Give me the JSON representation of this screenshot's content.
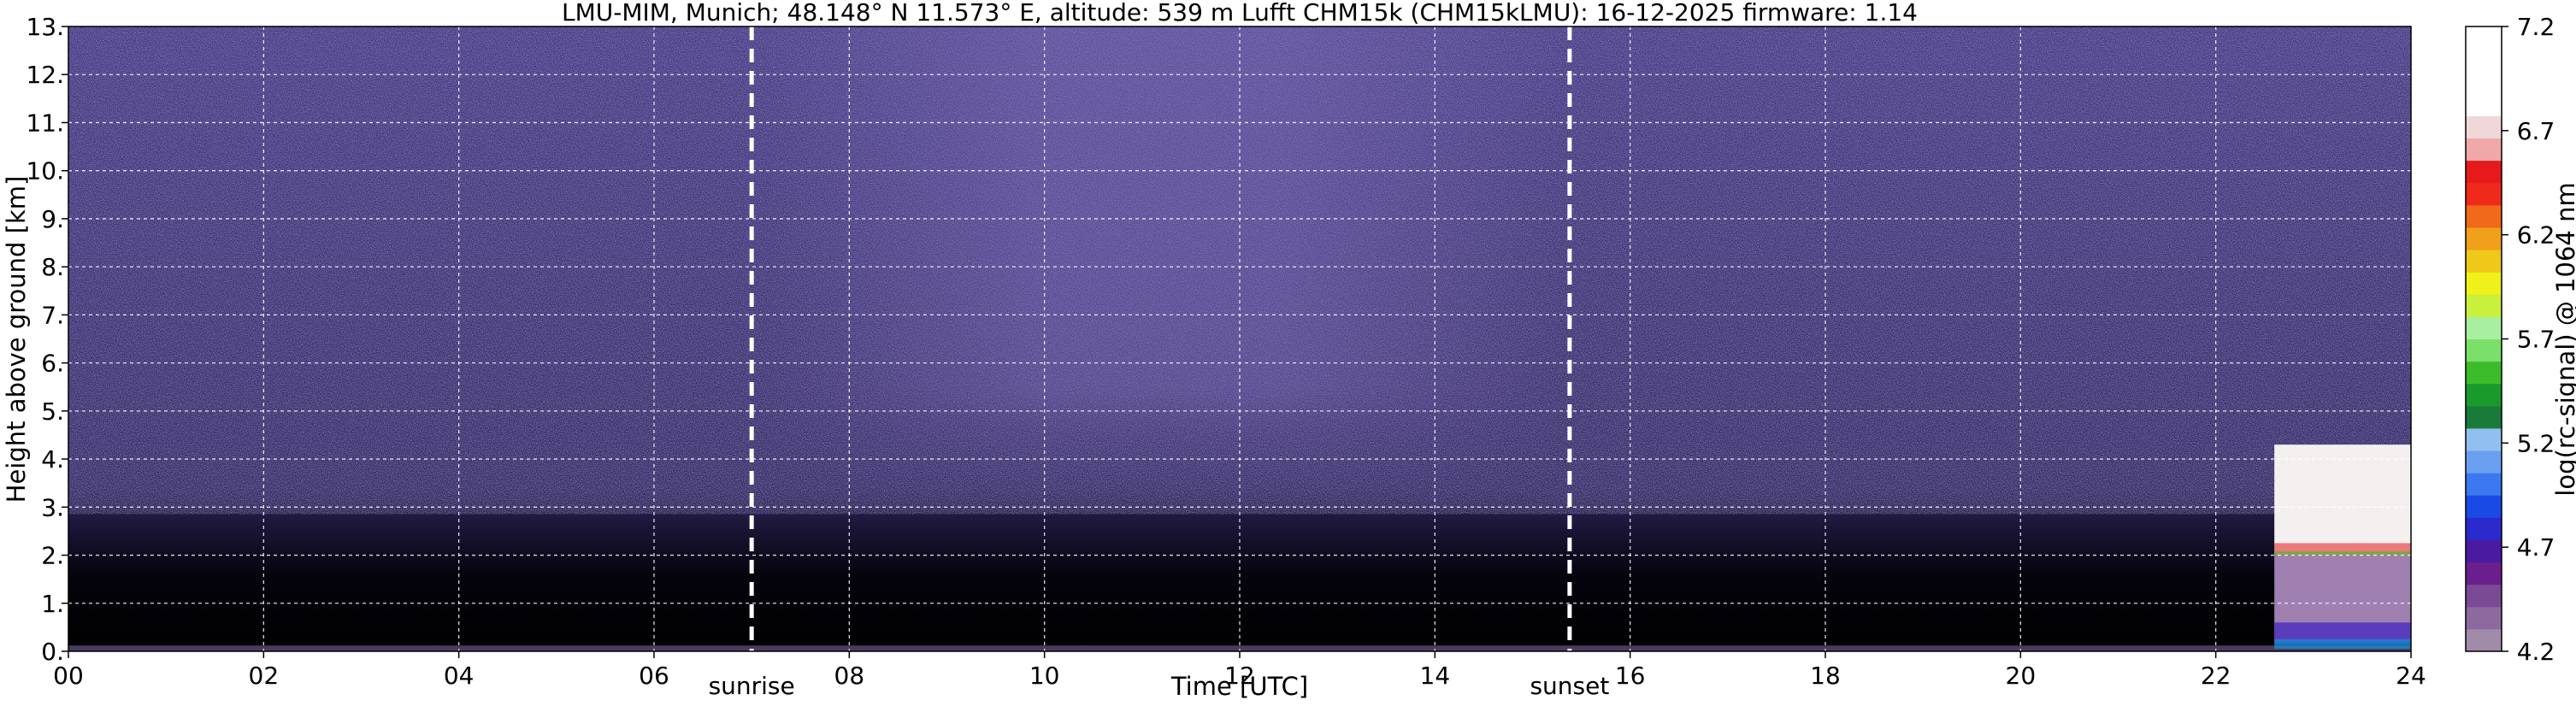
{
  "chart_data": {
    "type": "heatmap",
    "title": "LMU-MIM, Munich; 48.148° N 11.573° E, altitude: 539 m    Lufft CHM15k (CHM15kLMU): 16-12-2025    firmware: 1.14",
    "xlabel": "Time [UTC]",
    "ylabel": "Height above ground [km]",
    "xlim": [
      0,
      24
    ],
    "ylim": [
      0,
      13
    ],
    "x_ticks": [
      "00",
      "02",
      "04",
      "06",
      "08",
      "10",
      "12",
      "14",
      "16",
      "18",
      "20",
      "22",
      "24"
    ],
    "y_ticks": [
      "0.",
      "1.",
      "2.",
      "3.",
      "4.",
      "5.",
      "6.",
      "7.",
      "8.",
      "9.",
      "10.",
      "11.",
      "12.",
      "13."
    ],
    "grid": true,
    "colorbar": {
      "label": "log(rc-signal) @ 1064 nm",
      "range": [
        4.2,
        7.2
      ],
      "ticks": [
        "4.2",
        "4.7",
        "5.2",
        "5.7",
        "6.2",
        "6.7",
        "7.2"
      ],
      "colors": [
        "#a08ca8",
        "#8c6aa0",
        "#7a4a94",
        "#6a1f8c",
        "#4a1aa0",
        "#2a2acc",
        "#1a4ae6",
        "#3c78f0",
        "#6aa0f0",
        "#90c0f0",
        "#1a7a3a",
        "#1a9a2a",
        "#3cbc2a",
        "#7ae06a",
        "#a8f0a0",
        "#c8f03c",
        "#f0f01a",
        "#f0c81a",
        "#f0a01a",
        "#f06a1a",
        "#f02a1a",
        "#e61a1a",
        "#f0a8a8",
        "#f0d8d8",
        "#ffffff",
        "#ffffff",
        "#ffffff",
        "#ffffff"
      ]
    },
    "annotations": [
      {
        "text": "sunrise",
        "x": 7.0
      },
      {
        "text": "sunset",
        "x": 15.38
      }
    ],
    "features": {
      "background_noise_color": "#3c3270",
      "cloud_start_hour": 22.6,
      "cloud_base_km": 2.0,
      "cloud_top_km": 4.3
    }
  }
}
